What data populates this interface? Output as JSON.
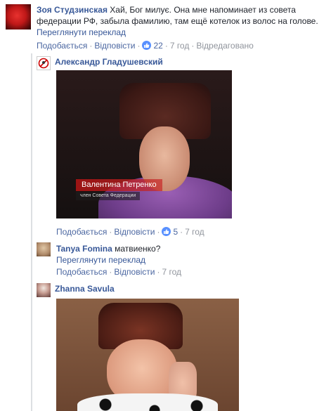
{
  "comments": [
    {
      "author": "Зоя Студзинская",
      "text": "Хай, Бог милує. Она мне напоминает из совета федерации РФ, забыла фамилию, там ещё котелок из волос на голове.",
      "see_translation": "Переглянути переклад",
      "actions": {
        "like": "Подобається",
        "reply": "Відповісти",
        "likes_count": "22",
        "time": "7 год",
        "edited": "Відредаговано"
      }
    }
  ],
  "replies": [
    {
      "author": "Александр Гладушевский",
      "photo_caption": {
        "name": "Валентина Петренко",
        "title": "член Совета Федерации"
      },
      "actions": {
        "like": "Подобається",
        "reply": "Відповісти",
        "likes_count": "5",
        "time": "7 год"
      }
    },
    {
      "author": "Tanya Fomina",
      "text": "матвиенко?",
      "see_translation": "Переглянути переклад",
      "actions": {
        "like": "Подобається",
        "reply": "Відповісти",
        "time": "7 год"
      }
    },
    {
      "author": "Zhanna Savula"
    }
  ],
  "colors": {
    "link": "#385898",
    "meta": "#90949c",
    "like_badge": "#5890ff",
    "rail": "#dddfe2"
  },
  "icons": [
    "like-badge-icon",
    "no-avatar-icon"
  ]
}
